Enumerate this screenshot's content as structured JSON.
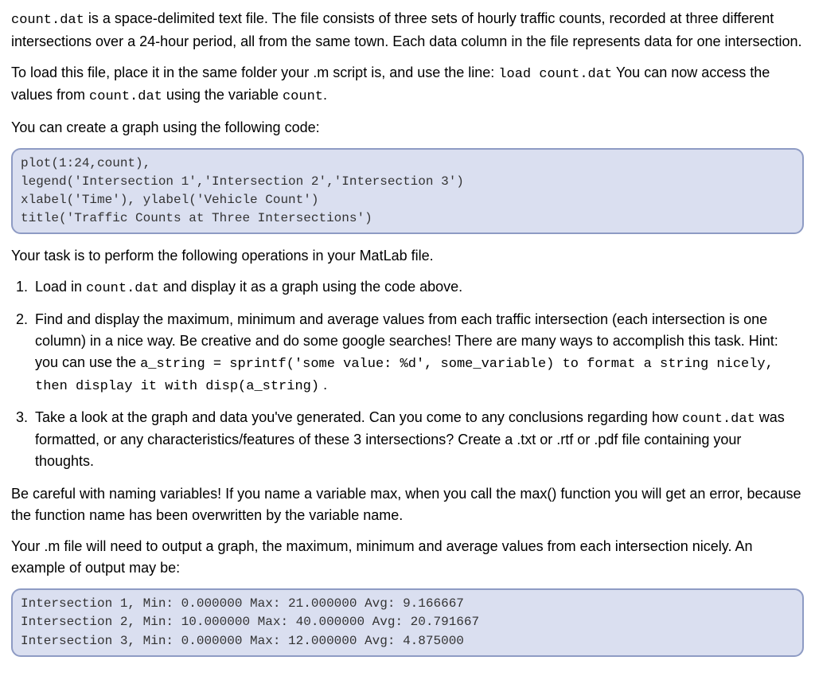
{
  "intro": {
    "file1": "count.dat",
    "p1a": " is a space-delimited text file. The file consists of three sets of hourly traffic counts, recorded at three different intersections over a 24-hour period, all from the same town. Each data column in the file represents data for one intersection.",
    "p2a": "To load this file, place it in the same folder your .m script is, and use the line: ",
    "load_cmd": "load count.dat",
    "p2b": " You can now access the values from ",
    "file2": "count.dat",
    "p2c": " using the variable ",
    "var1": "count",
    "p2d": ".",
    "p3": "You can create a graph using the following code:"
  },
  "code1": "plot(1:24,count),\nlegend('Intersection 1','Intersection 2','Intersection 3')\nxlabel('Time'), ylabel('Vehicle Count')\ntitle('Traffic Counts at Three Intersections')",
  "task_intro": "Your task is to perform the following operations in your MatLab file.",
  "items": {
    "i1a": "Load in ",
    "i1_file": "count.dat",
    "i1b": " and display it as a graph using the code above.",
    "i2a": "Find and display the maximum, minimum and average values from each traffic intersection (each intersection is one column) in a nice way. Be creative and do some google searches! There are many ways to accomplish this task. Hint: you can use the ",
    "i2_code": "a_string = sprintf('some value:  %d', some_variable) to format a string nicely, then display it with disp(a_string)",
    "i2b": " .",
    "i3a": "Take a look at the graph and data you've generated. Can you come to any conclusions regarding how ",
    "i3_file": "count.dat",
    "i3b": " was formatted, or any characteristics/features of these 3 intersections? Create a .txt or .rtf or .pdf file containing your thoughts."
  },
  "warn": "Be careful with naming variables! If you name a variable max, when you call the max() function you will get an error, because the function name has been overwritten by the variable name.",
  "outro": "Your .m file will need to output a graph, the maximum, minimum and average values from each intersection nicely. An example of output may be:",
  "code2": "Intersection 1, Min: 0.000000 Max: 21.000000 Avg: 9.166667\nIntersection 2, Min: 10.000000 Max: 40.000000 Avg: 20.791667\nIntersection 3, Min: 0.000000 Max: 12.000000 Avg: 4.875000"
}
